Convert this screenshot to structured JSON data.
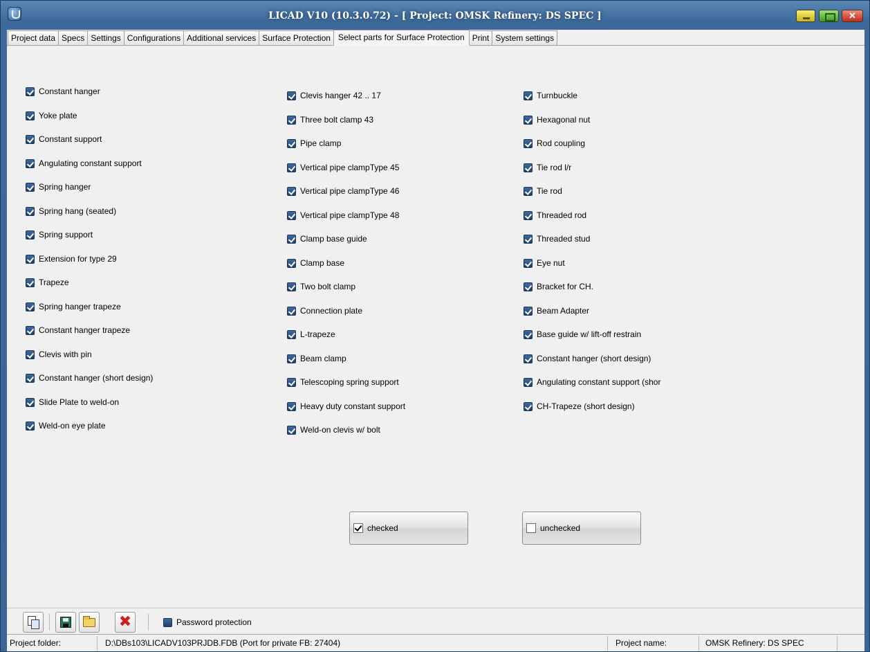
{
  "window": {
    "title": "LICAD V10 (10.3.0.72) -  [ Project: OMSK Refinery: DS SPEC ]",
    "close_glyph": "✕"
  },
  "tabs": [
    {
      "label": "Project data",
      "active": false
    },
    {
      "label": "Specs",
      "active": false
    },
    {
      "label": "Settings",
      "active": false
    },
    {
      "label": "Configurations",
      "active": false
    },
    {
      "label": "Additional services",
      "active": false
    },
    {
      "label": "Surface Protection",
      "active": false
    },
    {
      "label": "Select parts for Surface Protection",
      "active": true
    },
    {
      "label": "Print",
      "active": false
    },
    {
      "label": "System settings",
      "active": false
    }
  ],
  "columns": [
    {
      "items": [
        "Constant hanger",
        "Yoke plate",
        "Constant support",
        "Angulating constant support",
        "Spring hanger",
        "Spring hang (seated)",
        "Spring support",
        "Extension for type 29",
        "Trapeze",
        "Spring hanger trapeze",
        "Constant hanger trapeze",
        "Clevis with pin",
        "Constant hanger (short design)",
        "Slide Plate to weld-on",
        "Weld-on eye plate"
      ]
    },
    {
      "items": [
        "Clevis hanger 42 .. 17",
        "Three bolt clamp 43",
        "Pipe clamp",
        "Vertical pipe clampType 45",
        "Vertical pipe clampType 46",
        "Vertical pipe clampType 48",
        "Clamp base guide",
        "Clamp base",
        "Two bolt clamp",
        "Connection plate",
        "L-trapeze",
        "Beam clamp",
        "Telescoping spring support",
        "Heavy duty constant support",
        "Weld-on clevis w/ bolt"
      ]
    },
    {
      "items": [
        "Turnbuckle",
        "Hexagonal nut",
        "Rod coupling",
        "Tie rod l/r",
        "Tie rod",
        "Threaded rod",
        "Threaded stud",
        "Eye nut",
        "Bracket for CH.",
        "Beam Adapter",
        "Base guide w/ lift-off restrain",
        "Constant hanger (short design)",
        "Angulating constant support (shor",
        "CH-Trapeze (short design)"
      ]
    }
  ],
  "buttons": {
    "checked_label": "checked",
    "unchecked_label": "unchecked"
  },
  "toolbar": {
    "password_label": "Password protection"
  },
  "statusbar": {
    "folder_label": "Project folder:",
    "folder_value": "D:\\DBs103\\LICADV103PRJDB.FDB (Port for private FB: 27404)",
    "name_label": "Project name:",
    "name_value": "OMSK Refinery: DS SPEC"
  }
}
